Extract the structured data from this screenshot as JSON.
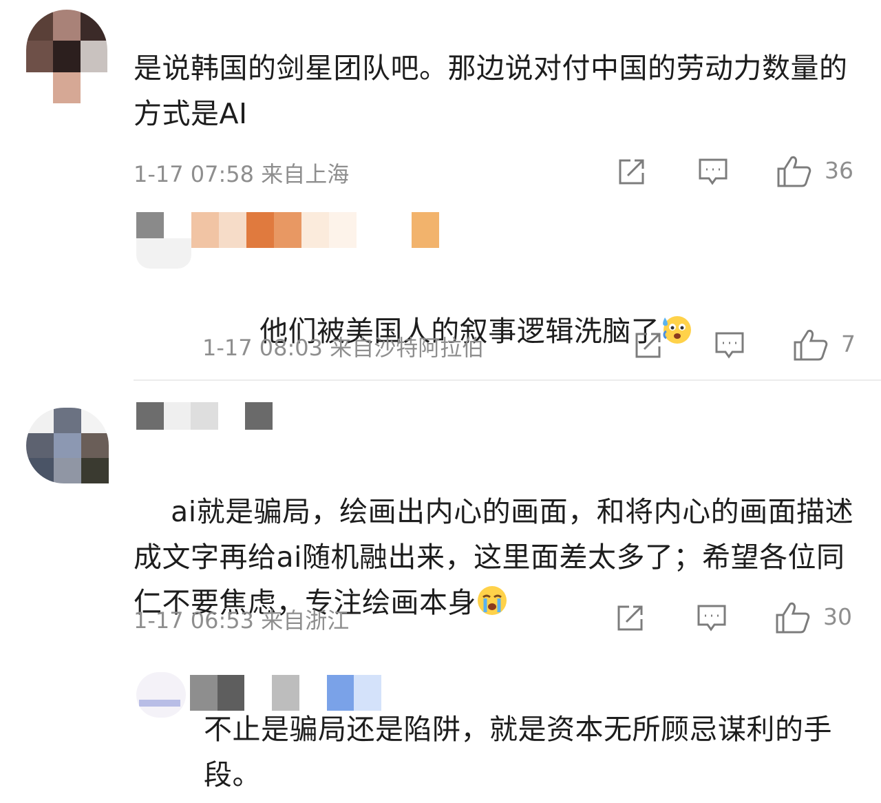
{
  "comments": [
    {
      "text": "是说韩国的剑星团队吧。那边说对付中国的劳动力数量的方式是AI",
      "meta": "1-17 07:58  来自上海",
      "likes": "36",
      "reply": {
        "text": "他们被美国人的叙事逻辑洗脑了",
        "emoji": "anxious-sweat-emoji",
        "meta": "1-17 08:03  来自沙特阿拉伯",
        "likes": "7"
      }
    },
    {
      "text": "ai就是骗局，绘画出内心的画面，和将内心的画面描述成文字再给ai随机融出来，这里面差太多了；希望各位同仁不要焦虑，专注绘画本身",
      "emoji": "crying-emoji",
      "meta": "1-17 06:53  来自浙江",
      "likes": "30",
      "reply": {
        "text": "不止是骗局还是陷阱，就是资本无所顾忌谋利的手段。"
      }
    }
  ],
  "icons": [
    "share-icon",
    "comment-icon",
    "like-icon"
  ],
  "colors": {
    "text": "#1d1d1d",
    "meta": "#8e8e8e",
    "divider": "#ececec"
  }
}
